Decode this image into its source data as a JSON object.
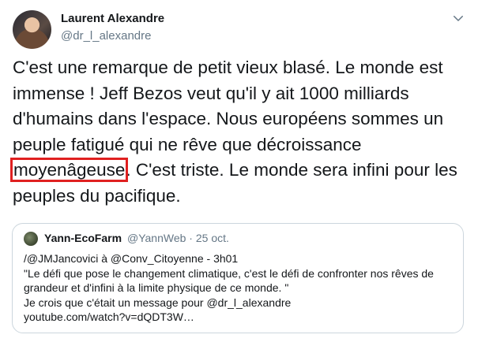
{
  "author": {
    "name": "Laurent Alexandre",
    "handle": "@dr_l_alexandre"
  },
  "tweet": {
    "text_before": "C'est une remarque de petit vieux blasé. Le monde est immense ! Jeff Bezos veut qu'il y ait 1000 milliards d'humains dans l'espace. Nous européens sommes un peuple fatigué qui ne rêve que décroissance ",
    "highlighted": "moyenâgeuse",
    "text_after": ". C'est triste. Le monde sera infini pour les peuples du pacifique.",
    "highlight_color": "#e02020"
  },
  "quoted": {
    "name": "Yann-EcoFarm",
    "handle": "@YannWeb",
    "separator": "·",
    "date": "25 oct.",
    "lines": [
      "/@JMJancovici à @Conv_Citoyenne - 3h01",
      "\"Le défi que pose le changement climatique, c'est le défi de confronter nos rêves de grandeur et d'infini  à la limite physique de ce monde. \"",
      "Je crois que c'était un message pour @dr_l_alexandre",
      "youtube.com/watch?v=dQDT3W…"
    ]
  },
  "icons": {
    "caret": "chevron-down-icon"
  }
}
